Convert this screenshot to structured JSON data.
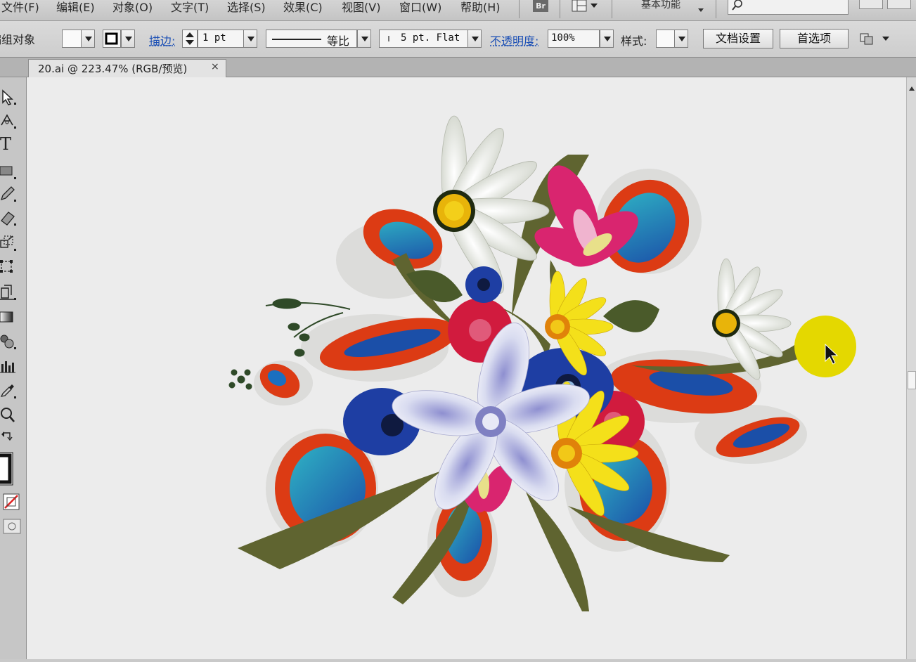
{
  "menubar": {
    "items": [
      {
        "label": "文件(F)"
      },
      {
        "label": "编辑(E)"
      },
      {
        "label": "对象(O)"
      },
      {
        "label": "文字(T)"
      },
      {
        "label": "选择(S)"
      },
      {
        "label": "效果(C)"
      },
      {
        "label": "视图(V)"
      },
      {
        "label": "窗口(W)"
      },
      {
        "label": "帮助(H)"
      }
    ],
    "bridge_label": "Br",
    "workspace_label": "基本功能"
  },
  "controlbar": {
    "selection_label": "编组对象",
    "stroke_label": "描边:",
    "stroke_weight": "1 pt",
    "stroke_profile_label": "等比",
    "brush_value": "5 pt. Flat",
    "opacity_label": "不透明度:",
    "opacity_value": "100%",
    "style_label": "样式:",
    "doc_setup_button": "文档设置",
    "prefs_button": "首选项"
  },
  "document_tab": {
    "title": "20.ai @ 223.47% (RGB/预览)",
    "close_glyph": "×"
  },
  "toolbar": {
    "text_tool_glyph": "T"
  },
  "colors": {
    "canvas_bg": "#ececec",
    "link_blue": "#1b4fb5",
    "cursor_highlight": "#e4d800"
  }
}
